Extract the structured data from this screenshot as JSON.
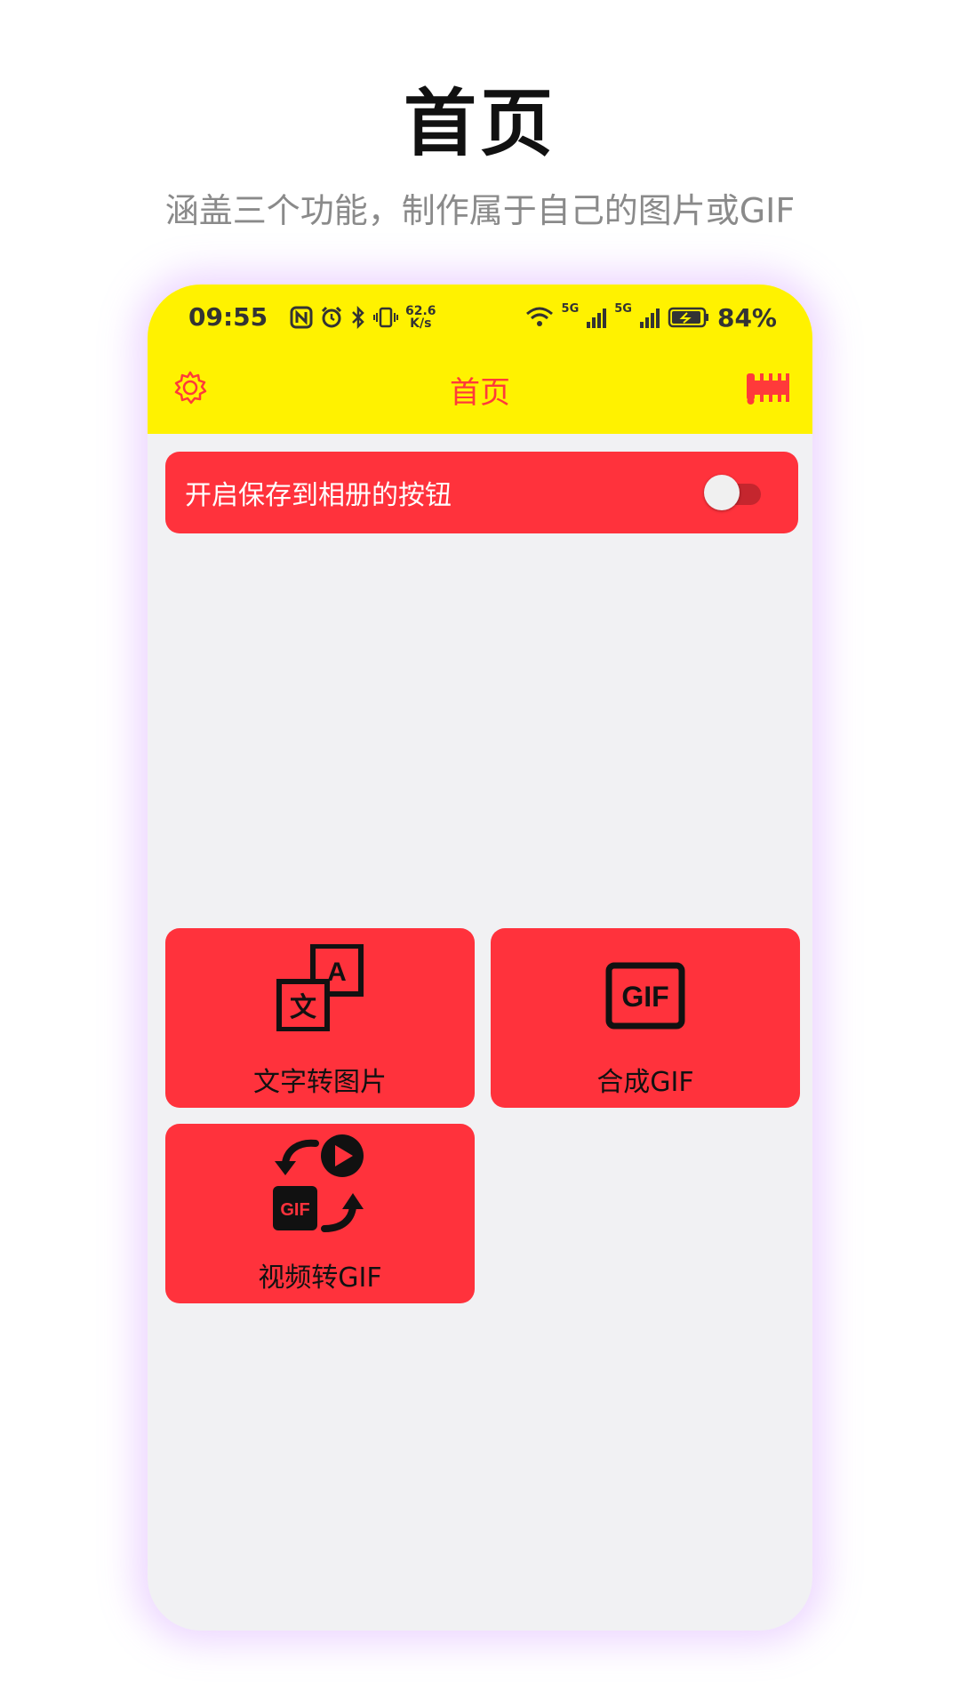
{
  "promo": {
    "title": "首页",
    "subtitle": "涵盖三个功能，制作属于自己的图片或GIF"
  },
  "status_bar": {
    "time": "09:55",
    "speed_value": "62.6",
    "speed_unit": "K/s",
    "net1": "5G",
    "net2": "5G",
    "battery": "84%"
  },
  "navbar": {
    "title": "首页",
    "left_icon": "gear-icon",
    "right_icon": "ruler-icon"
  },
  "save_toggle": {
    "label": "开启保存到相册的按钮",
    "on": false
  },
  "features": [
    {
      "label": "文字转图片",
      "icon": "text-to-image-icon"
    },
    {
      "label": "合成GIF",
      "icon": "gif-icon"
    },
    {
      "label": "视频转GIF",
      "icon": "video-to-gif-icon"
    }
  ],
  "colors": {
    "topbar": "#fff200",
    "accent": "#ff323c",
    "nav_title": "#ff3a3a",
    "background": "#f1f1f3"
  }
}
